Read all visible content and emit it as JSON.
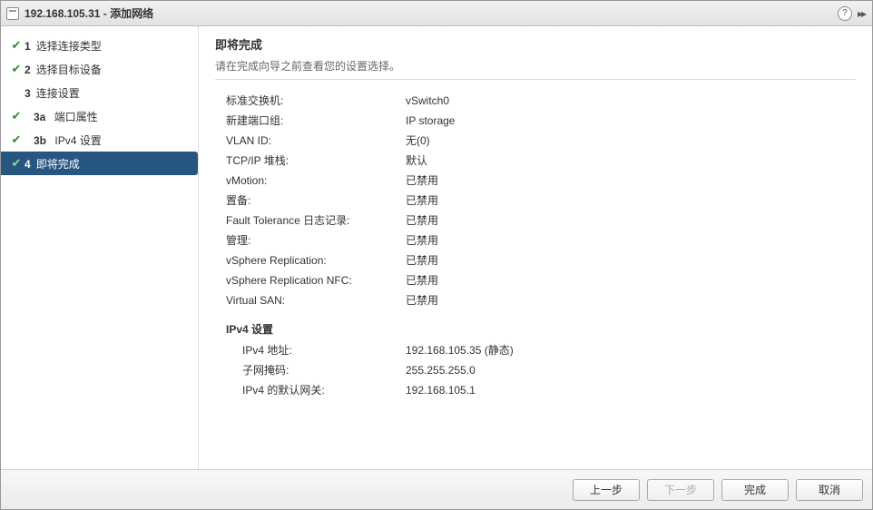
{
  "titlebar": {
    "title": "192.168.105.31 - 添加网络",
    "help_glyph": "?",
    "expand_glyph": "▸▸"
  },
  "sidebar": {
    "steps": [
      {
        "num": "1",
        "label": "选择连接类型",
        "done": true,
        "active": false,
        "sub": false
      },
      {
        "num": "2",
        "label": "选择目标设备",
        "done": true,
        "active": false,
        "sub": false
      },
      {
        "num": "3",
        "label": "连接设置",
        "done": false,
        "active": false,
        "sub": false
      },
      {
        "num": "3a",
        "label": "端口属性",
        "done": true,
        "active": false,
        "sub": true
      },
      {
        "num": "3b",
        "label": "IPv4 设置",
        "done": true,
        "active": false,
        "sub": true
      },
      {
        "num": "4",
        "label": "即将完成",
        "done": true,
        "active": true,
        "sub": false
      }
    ]
  },
  "content": {
    "heading": "即将完成",
    "subtitle": "请在完成向导之前查看您的设置选择。",
    "rows": [
      {
        "k": "标准交换机:",
        "v": "vSwitch0"
      },
      {
        "k": "新建端口组:",
        "v": "IP storage"
      },
      {
        "k": "VLAN ID:",
        "v": "无(0)"
      },
      {
        "k": "TCP/IP 堆栈:",
        "v": "默认"
      },
      {
        "k": "vMotion:",
        "v": "已禁用"
      },
      {
        "k": "置备:",
        "v": "已禁用"
      },
      {
        "k": "Fault Tolerance 日志记录:",
        "v": "已禁用"
      },
      {
        "k": "管理:",
        "v": "已禁用"
      },
      {
        "k": "vSphere Replication:",
        "v": "已禁用"
      },
      {
        "k": "vSphere Replication NFC:",
        "v": "已禁用"
      },
      {
        "k": "Virtual SAN:",
        "v": "已禁用"
      }
    ],
    "ipv4_header": "IPv4 设置",
    "ipv4_rows": [
      {
        "k": "IPv4 地址:",
        "v": "192.168.105.35 (静态)"
      },
      {
        "k": "子网掩码:",
        "v": "255.255.255.0"
      },
      {
        "k": "IPv4 的默认网关:",
        "v": "192.168.105.1"
      }
    ]
  },
  "footer": {
    "back": "上一步",
    "next": "下一步",
    "finish": "完成",
    "cancel": "取消"
  }
}
